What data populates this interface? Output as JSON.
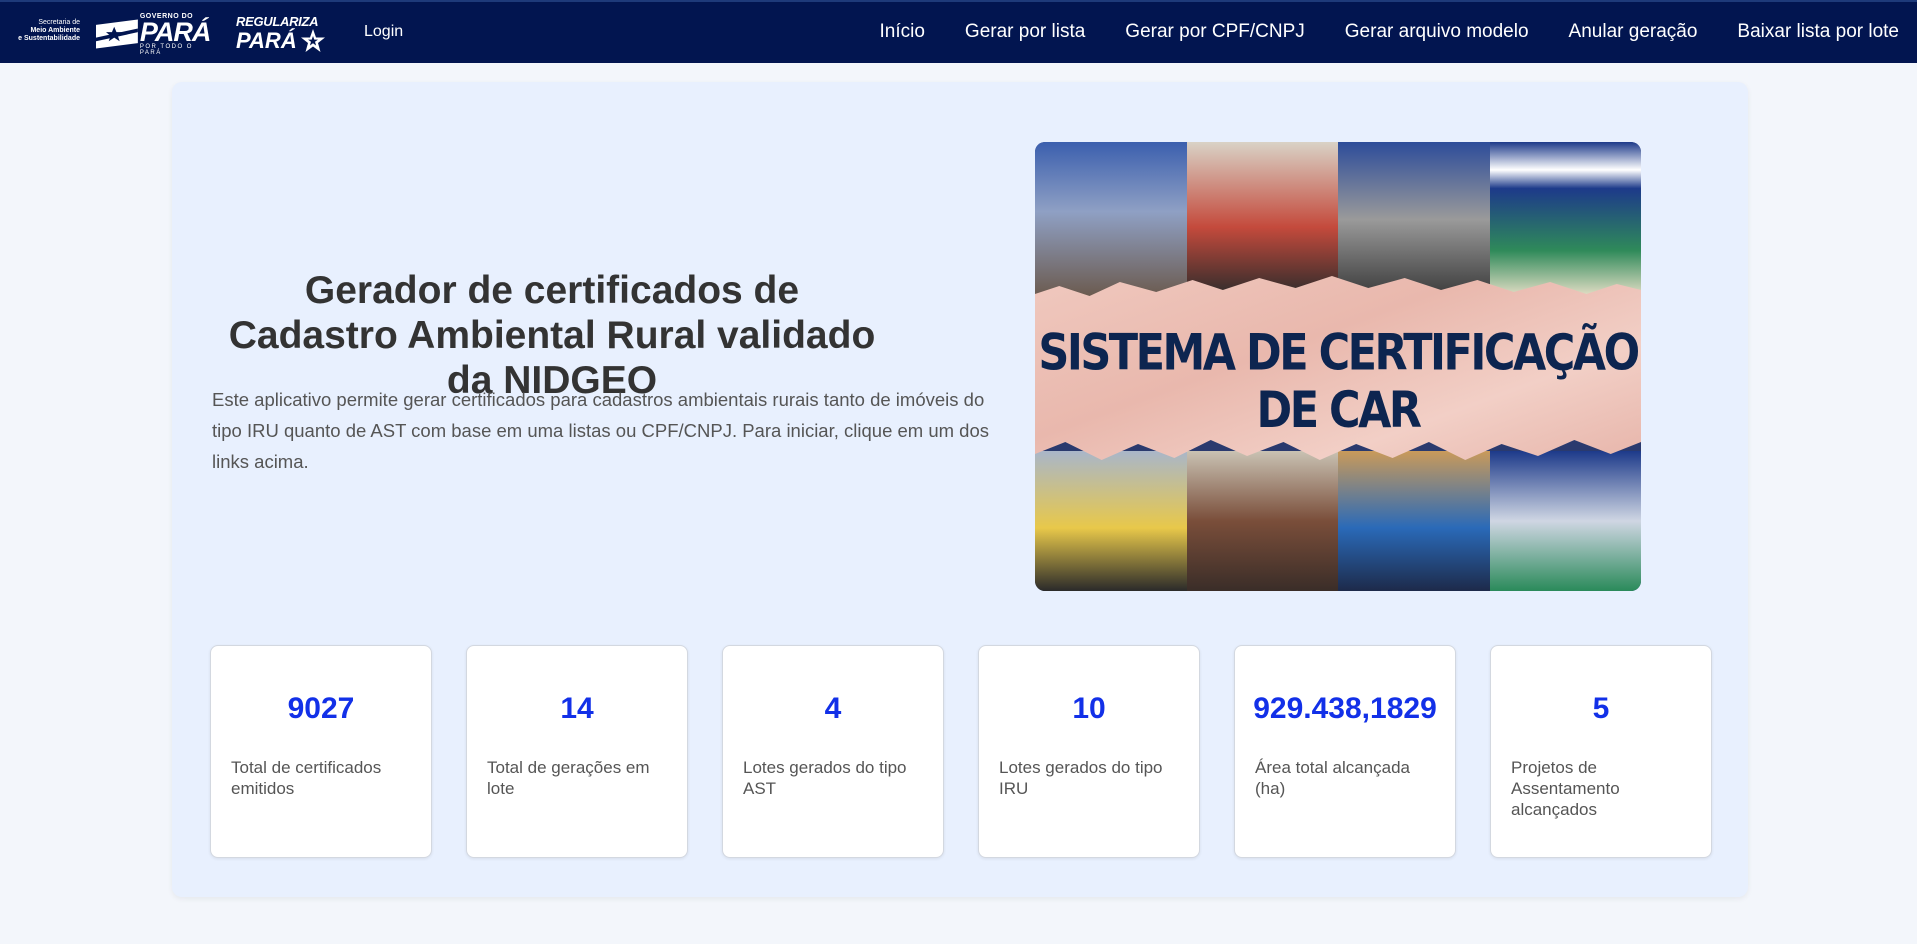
{
  "header": {
    "secretaria_lines": [
      "Secretaria de",
      "Meio Ambiente",
      "e Sustentabilidade"
    ],
    "gov_top": "GOVERNO DO",
    "gov_big": "PARÁ",
    "gov_sub": "POR TODO O PARÁ",
    "regulariza_top": "REGULARIZA",
    "regulariza_bottom": "PARÁ",
    "login": "Login",
    "nav": [
      "Início",
      "Gerar por lista",
      "Gerar por CPF/CNPJ",
      "Gerar arquivo modelo",
      "Anular geração",
      "Baixar lista por lote"
    ],
    "colors": {
      "navbar_bg": "#021550"
    }
  },
  "hero": {
    "title": "Gerador de certificados de Cadastro Ambiental Rural validado da NIDGEO",
    "description": "Este aplicativo permite gerar certificados para cadastros ambientais rurais tanto de imóveis do tipo IRU quanto de AST com base em uma listas ou CPF/CNPJ. Para iniciar, clique em um dos links acima.",
    "image_banner": "SISTEMA DE CERTIFICAÇÃO DE CAR"
  },
  "stats": [
    {
      "value": "9027",
      "label": "Total de certificados emitidos"
    },
    {
      "value": "14",
      "label": "Total de gerações em lote"
    },
    {
      "value": "4",
      "label": "Lotes gerados do tipo AST"
    },
    {
      "value": "10",
      "label": "Lotes gerados do tipo IRU"
    },
    {
      "value": "929.438,1829",
      "label": "Área total alcançada (ha)"
    },
    {
      "value": "5",
      "label": "Projetos de Assentamento alcançados"
    }
  ],
  "colors": {
    "accent": "#1230e8",
    "card_bg": "#e8f0fe",
    "page_bg": "#f3f6fb"
  }
}
